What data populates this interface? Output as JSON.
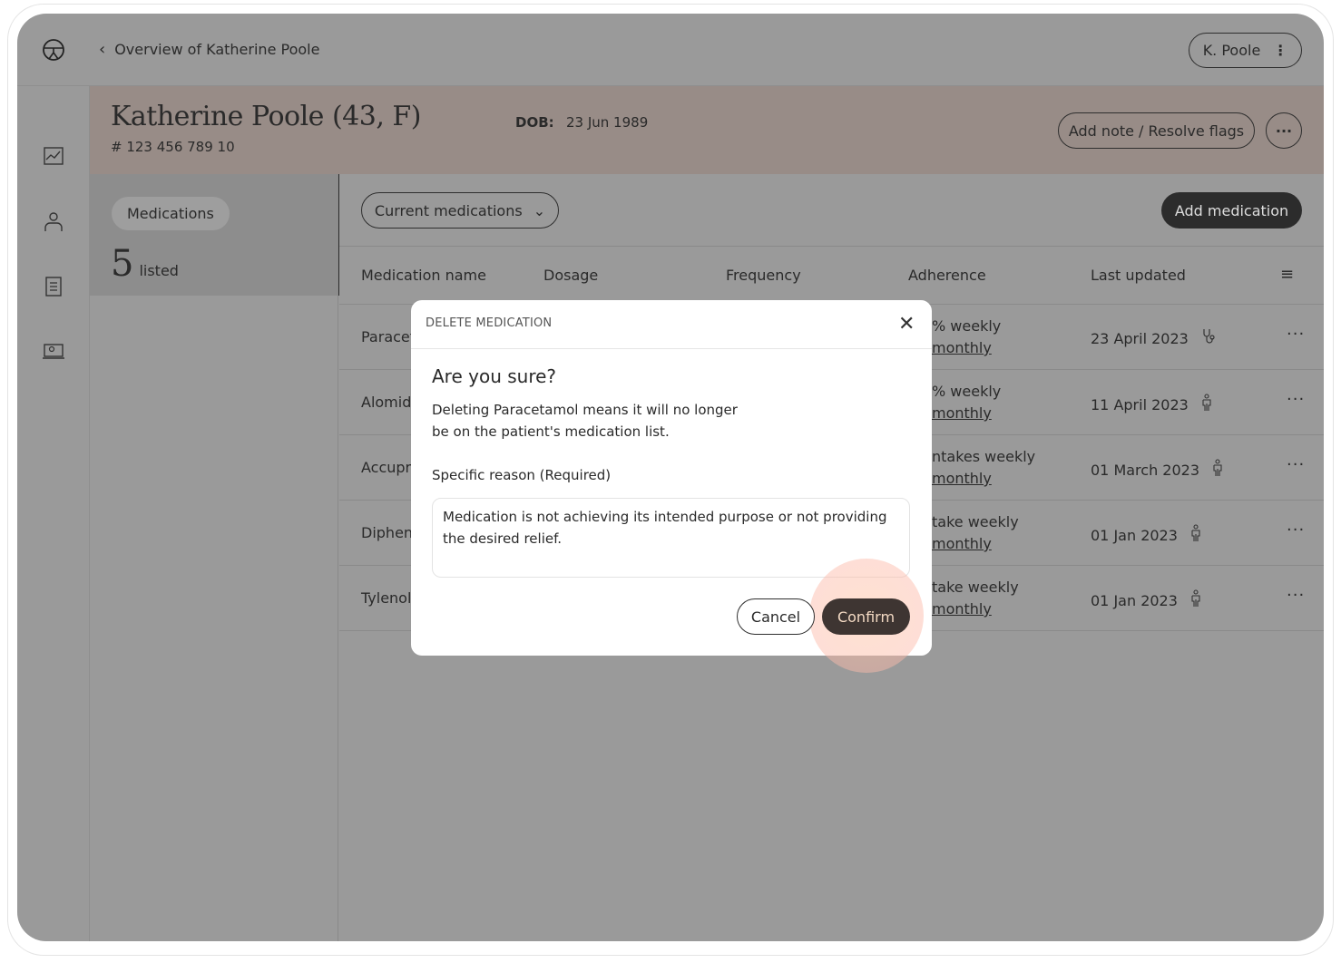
{
  "topbar": {
    "back_label": "Overview of Katherine Poole",
    "user_label": "K. Poole"
  },
  "rail": {
    "icons": [
      "logo-icon",
      "chart-icon",
      "person-icon",
      "document-icon",
      "screen-user-icon"
    ]
  },
  "patient": {
    "name": "Katherine Poole (43, F)",
    "id": "# 123 456 789 10",
    "dob_label": "DOB:",
    "dob": "23 Jun 1989",
    "add_note_label": "Add note / Resolve flags",
    "more_label": "···"
  },
  "left": {
    "tab_label": "Medications",
    "count": "5",
    "count_label": "listed"
  },
  "toolbar": {
    "filter_label": "Current medications",
    "add_label": "Add medication"
  },
  "table": {
    "headers": [
      "Medication name",
      "Dosage",
      "Frequency",
      "Adherence",
      "Last updated"
    ],
    "rows": [
      {
        "name": "Paracet",
        "adh1": "% weekly",
        "adh2": "monthly",
        "updated": "23 April 2023",
        "icon": "stethoscope-icon"
      },
      {
        "name": "Alomid",
        "adh1": "% weekly",
        "adh2": "monthly",
        "updated": "11 April 2023",
        "icon": "person-icon"
      },
      {
        "name": "Accupri",
        "adh1": "ntakes weekly",
        "adh2": "monthly",
        "updated": "01 March 2023",
        "icon": "person-icon"
      },
      {
        "name": "Diphen",
        "adh1": "take weekly",
        "adh2": "monthly",
        "updated": "01 Jan 2023",
        "icon": "person-icon"
      },
      {
        "name": "Tylenol",
        "adh1": "take weekly",
        "adh2": "monthly",
        "updated": "01 Jan 2023",
        "icon": "person-icon"
      }
    ]
  },
  "modal": {
    "title": "DELETE MEDICATION",
    "heading": "Are you sure?",
    "body_line1": "Deleting Paracetamol means it will no longer",
    "body_line2": "be on the patient's medication list.",
    "reason_label": "Specific reason (Required)",
    "reason_value": "Medication is not achieving its intended purpose or not providing the desired relief.",
    "cancel_label": "Cancel",
    "confirm_label": "Confirm"
  },
  "colors": {
    "overlay": "#9a9a9a",
    "header_band": "#988c87",
    "confirm_bg": "#3e3532",
    "confirm_text": "#f3d9c3",
    "add_med_bg": "#2c2c2c"
  }
}
